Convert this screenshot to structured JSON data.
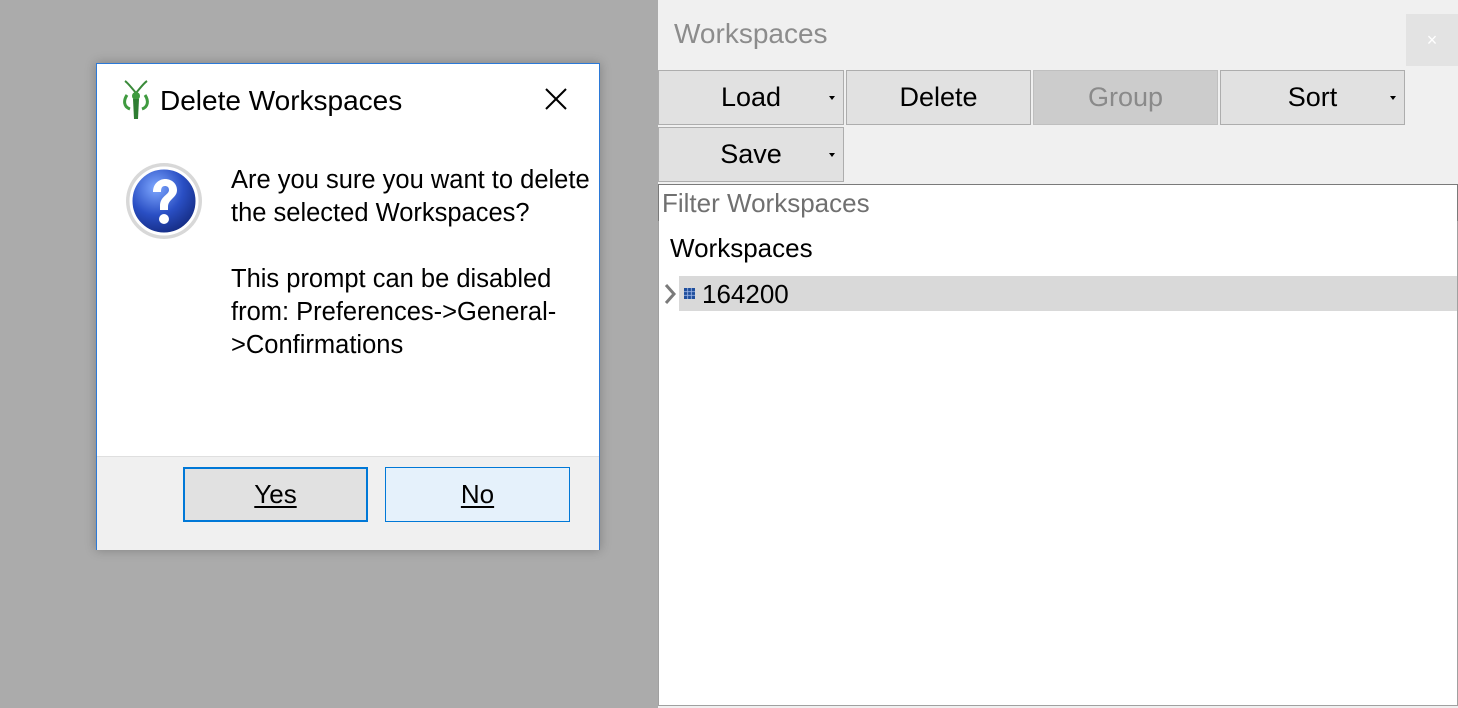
{
  "panel": {
    "title": "Workspaces",
    "close_icon": "×",
    "toolbar": {
      "load_label": "Load",
      "delete_label": "Delete",
      "group_label": "Group",
      "sort_label": "Sort",
      "save_label": "Save"
    },
    "filter": {
      "placeholder": "Filter Workspaces",
      "value": ""
    },
    "tree": {
      "header": "Workspaces",
      "items": [
        {
          "label": "164200",
          "icon": "matrix-workspace-icon",
          "selected": true
        }
      ]
    }
  },
  "dialog": {
    "title": "Delete Workspaces",
    "app_icon": "mantid-icon",
    "message_icon": "question-icon",
    "message_lines": [
      "Are you sure you want to delete the selected Workspaces?",
      "This prompt can be disabled from: Preferences->General->Confirmations"
    ],
    "buttons": {
      "yes": "Yes",
      "no": "No"
    }
  },
  "colors": {
    "desktop": "#ababab",
    "panel_bg": "#f0f0f0",
    "accent": "#0078d7",
    "selected_row": "#d9d9d9",
    "dialog_border": "#2b79d8"
  }
}
